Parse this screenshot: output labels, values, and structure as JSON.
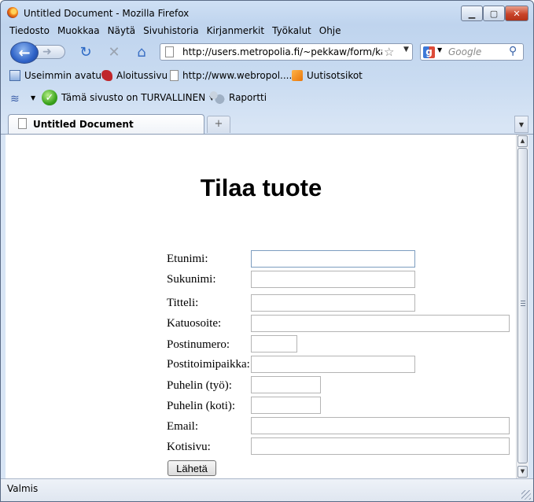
{
  "window": {
    "title": "Untitled Document - Mozilla Firefox"
  },
  "menubar": {
    "items": [
      "Tiedosto",
      "Muokkaa",
      "Näytä",
      "Sivuhistoria",
      "Kirjanmerkit",
      "Työkalut",
      "Ohje"
    ]
  },
  "navbar": {
    "url": "http://users.metropolia.fi/~pekkaw/form/kaynt",
    "search_placeholder": "Google"
  },
  "bookmarks": {
    "items": [
      "Useimmin avatut",
      "Aloitussivu",
      "http://www.webropol....",
      "Uutisotsikot"
    ]
  },
  "addonbar": {
    "security_label": "Tämä sivusto on TURVALLINEN",
    "report_label": "Raportti"
  },
  "tabs": {
    "active_label": "Untitled Document"
  },
  "page": {
    "heading": "Tilaa tuote",
    "fields": [
      {
        "label": "Etunimi:",
        "value": ""
      },
      {
        "label": "Sukunimi:",
        "value": ""
      },
      {
        "label": "Titteli:",
        "value": ""
      },
      {
        "label": "Katuosoite:",
        "value": ""
      },
      {
        "label": "Postinumero:",
        "value": ""
      },
      {
        "label": "Postitoimipaikka:",
        "value": ""
      },
      {
        "label": "Puhelin (työ):",
        "value": ""
      },
      {
        "label": "Puhelin (koti):",
        "value": ""
      },
      {
        "label": "Email:",
        "value": ""
      },
      {
        "label": "Kotisivu:",
        "value": ""
      }
    ],
    "submit_label": "Lähetä"
  },
  "statusbar": {
    "text": "Valmis"
  },
  "colors": {
    "chrome": "#c9dbf1",
    "back_button": "#2f63c8",
    "secure_check": "#3aa31c"
  }
}
